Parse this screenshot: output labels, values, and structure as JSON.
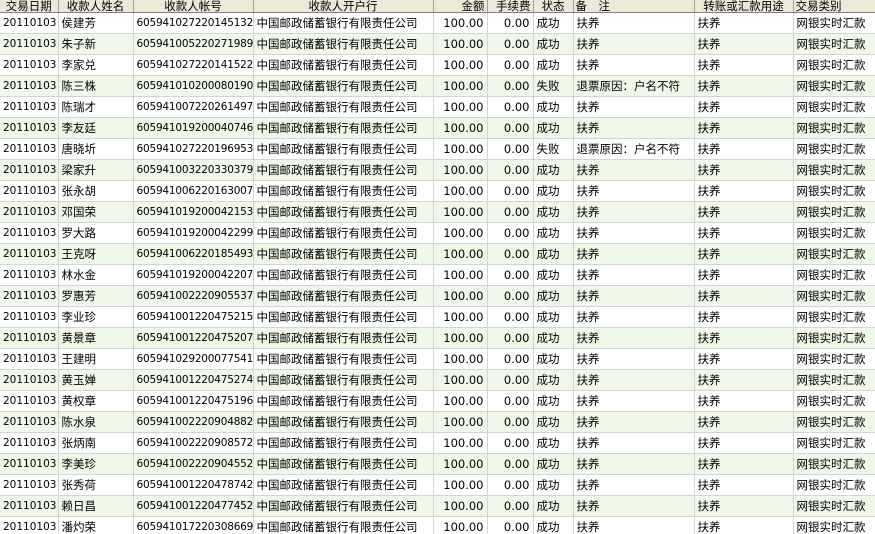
{
  "columns": [
    {
      "key": "date",
      "label": "交易日期"
    },
    {
      "key": "name",
      "label": "收款人姓名"
    },
    {
      "key": "account",
      "label": "收款人帐号"
    },
    {
      "key": "bank",
      "label": "收款人开户行"
    },
    {
      "key": "amount",
      "label": "金额"
    },
    {
      "key": "fee",
      "label": "手续费"
    },
    {
      "key": "status",
      "label": "状态"
    },
    {
      "key": "remark",
      "label": "备　注"
    },
    {
      "key": "purpose",
      "label": "转账或汇款用途"
    },
    {
      "key": "type",
      "label": "交易类别"
    }
  ],
  "rows": [
    {
      "date": "20110103",
      "name": "侯建芳",
      "account": "605941027220145132",
      "bank": "中国邮政储蓄银行有限责任公司",
      "amount": "100.00",
      "fee": "0.00",
      "status": "成功",
      "remark": "扶养",
      "purpose": "扶养",
      "type": "网银实时汇款"
    },
    {
      "date": "20110103",
      "name": "朱子新",
      "account": "605941005220271989",
      "bank": "中国邮政储蓄银行有限责任公司",
      "amount": "100.00",
      "fee": "0.00",
      "status": "成功",
      "remark": "扶养",
      "purpose": "扶养",
      "type": "网银实时汇款"
    },
    {
      "date": "20110103",
      "name": "李家兑",
      "account": "605941027220141522",
      "bank": "中国邮政储蓄银行有限责任公司",
      "amount": "100.00",
      "fee": "0.00",
      "status": "成功",
      "remark": "扶养",
      "purpose": "扶养",
      "type": "网银实时汇款"
    },
    {
      "date": "20110103",
      "name": "陈三株",
      "account": "605941010200080190",
      "bank": "中国邮政储蓄银行有限责任公司",
      "amount": "100.00",
      "fee": "0.00",
      "status": "失败",
      "remark": "退票原因：户名不符",
      "purpose": "扶养",
      "type": "网银实时汇款"
    },
    {
      "date": "20110103",
      "name": "陈瑞才",
      "account": "605941007220261497",
      "bank": "中国邮政储蓄银行有限责任公司",
      "amount": "100.00",
      "fee": "0.00",
      "status": "成功",
      "remark": "扶养",
      "purpose": "扶养",
      "type": "网银实时汇款"
    },
    {
      "date": "20110103",
      "name": "李友廷",
      "account": "605941019200040746",
      "bank": "中国邮政储蓄银行有限责任公司",
      "amount": "100.00",
      "fee": "0.00",
      "status": "成功",
      "remark": "扶养",
      "purpose": "扶养",
      "type": "网银实时汇款"
    },
    {
      "date": "20110103",
      "name": "唐晓圻",
      "account": "605941027220196953",
      "bank": "中国邮政储蓄银行有限责任公司",
      "amount": "100.00",
      "fee": "0.00",
      "status": "失败",
      "remark": "退票原因：户名不符",
      "purpose": "扶养",
      "type": "网银实时汇款"
    },
    {
      "date": "20110103",
      "name": "梁家升",
      "account": "605941003220330379",
      "bank": "中国邮政储蓄银行有限责任公司",
      "amount": "100.00",
      "fee": "0.00",
      "status": "成功",
      "remark": "扶养",
      "purpose": "扶养",
      "type": "网银实时汇款"
    },
    {
      "date": "20110103",
      "name": "张永胡",
      "account": "605941006220163007",
      "bank": "中国邮政储蓄银行有限责任公司",
      "amount": "100.00",
      "fee": "0.00",
      "status": "成功",
      "remark": "扶养",
      "purpose": "扶养",
      "type": "网银实时汇款"
    },
    {
      "date": "20110103",
      "name": "邓国荣",
      "account": "605941019200042153",
      "bank": "中国邮政储蓄银行有限责任公司",
      "amount": "100.00",
      "fee": "0.00",
      "status": "成功",
      "remark": "扶养",
      "purpose": "扶养",
      "type": "网银实时汇款"
    },
    {
      "date": "20110103",
      "name": "罗大路",
      "account": "605941019200042299",
      "bank": "中国邮政储蓄银行有限责任公司",
      "amount": "100.00",
      "fee": "0.00",
      "status": "成功",
      "remark": "扶养",
      "purpose": "扶养",
      "type": "网银实时汇款"
    },
    {
      "date": "20110103",
      "name": "王克呀",
      "account": "605941006220185493",
      "bank": "中国邮政储蓄银行有限责任公司",
      "amount": "100.00",
      "fee": "0.00",
      "status": "成功",
      "remark": "扶养",
      "purpose": "扶养",
      "type": "网银实时汇款"
    },
    {
      "date": "20110103",
      "name": "林水金",
      "account": "605941019200042207",
      "bank": "中国邮政储蓄银行有限责任公司",
      "amount": "100.00",
      "fee": "0.00",
      "status": "成功",
      "remark": "扶养",
      "purpose": "扶养",
      "type": "网银实时汇款"
    },
    {
      "date": "20110103",
      "name": "罗惠芳",
      "account": "605941002220905537",
      "bank": "中国邮政储蓄银行有限责任公司",
      "amount": "100.00",
      "fee": "0.00",
      "status": "成功",
      "remark": "扶养",
      "purpose": "扶养",
      "type": "网银实时汇款"
    },
    {
      "date": "20110103",
      "name": "李业珍",
      "account": "605941001220475215",
      "bank": "中国邮政储蓄银行有限责任公司",
      "amount": "100.00",
      "fee": "0.00",
      "status": "成功",
      "remark": "扶养",
      "purpose": "扶养",
      "type": "网银实时汇款"
    },
    {
      "date": "20110103",
      "name": "黄景章",
      "account": "605941001220475207",
      "bank": "中国邮政储蓄银行有限责任公司",
      "amount": "100.00",
      "fee": "0.00",
      "status": "成功",
      "remark": "扶养",
      "purpose": "扶养",
      "type": "网银实时汇款"
    },
    {
      "date": "20110103",
      "name": "王建明",
      "account": "605941029200077541",
      "bank": "中国邮政储蓄银行有限责任公司",
      "amount": "100.00",
      "fee": "0.00",
      "status": "成功",
      "remark": "扶养",
      "purpose": "扶养",
      "type": "网银实时汇款"
    },
    {
      "date": "20110103",
      "name": "黄玉婵",
      "account": "605941001220475274",
      "bank": "中国邮政储蓄银行有限责任公司",
      "amount": "100.00",
      "fee": "0.00",
      "status": "成功",
      "remark": "扶养",
      "purpose": "扶养",
      "type": "网银实时汇款"
    },
    {
      "date": "20110103",
      "name": "黄权章",
      "account": "605941001220475196",
      "bank": "中国邮政储蓄银行有限责任公司",
      "amount": "100.00",
      "fee": "0.00",
      "status": "成功",
      "remark": "扶养",
      "purpose": "扶养",
      "type": "网银实时汇款"
    },
    {
      "date": "20110103",
      "name": "陈水泉",
      "account": "605941002220904882",
      "bank": "中国邮政储蓄银行有限责任公司",
      "amount": "100.00",
      "fee": "0.00",
      "status": "成功",
      "remark": "扶养",
      "purpose": "扶养",
      "type": "网银实时汇款"
    },
    {
      "date": "20110103",
      "name": "张炳南",
      "account": "605941002220908572",
      "bank": "中国邮政储蓄银行有限责任公司",
      "amount": "100.00",
      "fee": "0.00",
      "status": "成功",
      "remark": "扶养",
      "purpose": "扶养",
      "type": "网银实时汇款"
    },
    {
      "date": "20110103",
      "name": "李美珍",
      "account": "605941002220904552",
      "bank": "中国邮政储蓄银行有限责任公司",
      "amount": "100.00",
      "fee": "0.00",
      "status": "成功",
      "remark": "扶养",
      "purpose": "扶养",
      "type": "网银实时汇款"
    },
    {
      "date": "20110103",
      "name": "张秀荷",
      "account": "605941001220478742",
      "bank": "中国邮政储蓄银行有限责任公司",
      "amount": "100.00",
      "fee": "0.00",
      "status": "成功",
      "remark": "扶养",
      "purpose": "扶养",
      "type": "网银实时汇款"
    },
    {
      "date": "20110103",
      "name": "赖日昌",
      "account": "605941001220477452",
      "bank": "中国邮政储蓄银行有限责任公司",
      "amount": "100.00",
      "fee": "0.00",
      "status": "成功",
      "remark": "扶养",
      "purpose": "扶养",
      "type": "网银实时汇款"
    },
    {
      "date": "20110103",
      "name": "潘灼荣",
      "account": "605941017220308669",
      "bank": "中国邮政储蓄银行有限责任公司",
      "amount": "100.00",
      "fee": "0.00",
      "status": "成功",
      "remark": "扶养",
      "purpose": "扶养",
      "type": "网银实时汇款"
    }
  ],
  "colors": {
    "header_bg": "#ece9d8",
    "row_alt_bg": "#f0f8e8",
    "grid_line": "#d4d4d4"
  }
}
